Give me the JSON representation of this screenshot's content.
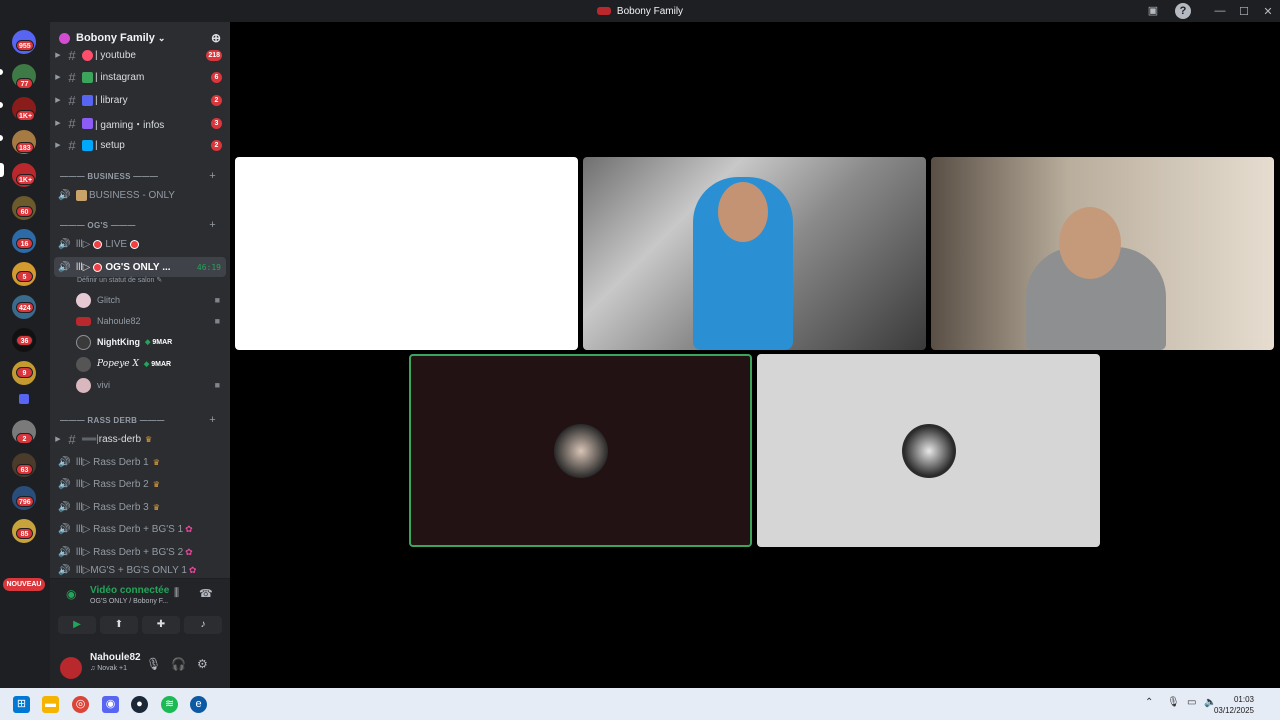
{
  "titlebar": {
    "title": "Bobony Family"
  },
  "guilds": {
    "badges": [
      "955",
      "77",
      "1K+",
      "183",
      "1K+",
      "60",
      "16",
      "5",
      "424",
      "36",
      "9",
      "2",
      "63",
      "796",
      "85"
    ],
    "new_label": "NOUVEAU"
  },
  "server": {
    "name": "Bobony Family"
  },
  "channels_top": [
    {
      "name": "| youtube",
      "count": "218",
      "color": "#ff4d6d"
    },
    {
      "name": "| instagram",
      "count": "6",
      "color": "#3ba55c"
    },
    {
      "name": "| library",
      "count": "2",
      "color": "#5865f2"
    },
    {
      "name": "| gaming・infos",
      "count": "3",
      "color": "#8b5cf6"
    },
    {
      "name": "| setup",
      "count": "2",
      "color": "#00a8fc"
    }
  ],
  "business": {
    "category": "——— BUSINESS ———",
    "channel": "BUSINESS - ONLY"
  },
  "ogs": {
    "category": "——— OG'S ———",
    "live": "LIVE",
    "selected": "OG'S ONLY ...",
    "timer": "46:19",
    "status_hint": "Définir un statut de salon ✎",
    "voice_users": [
      {
        "name": "Glitch",
        "tag": ""
      },
      {
        "name": "Nahoule82",
        "tag": ""
      },
      {
        "name": "NightKing",
        "tag": "9MAR"
      },
      {
        "name": "Popeye X",
        "tag": "9MAR"
      },
      {
        "name": "vivi",
        "tag": ""
      }
    ]
  },
  "rass": {
    "category": "——— RASS DERB ———",
    "text_channel": "rass-derb",
    "voice": [
      "Rass Derb 1",
      "Rass Derb 2",
      "Rass Derb 3",
      "Rass Derb + BG'S 1",
      "Rass Derb + BG'S 2",
      "MG'S + BG'S ONLY 1"
    ]
  },
  "voice_panel": {
    "status": "Vidéo connectée",
    "channel": "OG'S ONLY  / Bobony F..."
  },
  "user": {
    "name": "Nahoule82",
    "activity": "♫ Novak +1"
  },
  "clock": {
    "time": "01:03",
    "date": "03/12/2025"
  },
  "colors": {
    "accent_green": "#3ba55c",
    "badge_red": "#da373c",
    "sidebar_bg": "#2b2d31"
  }
}
